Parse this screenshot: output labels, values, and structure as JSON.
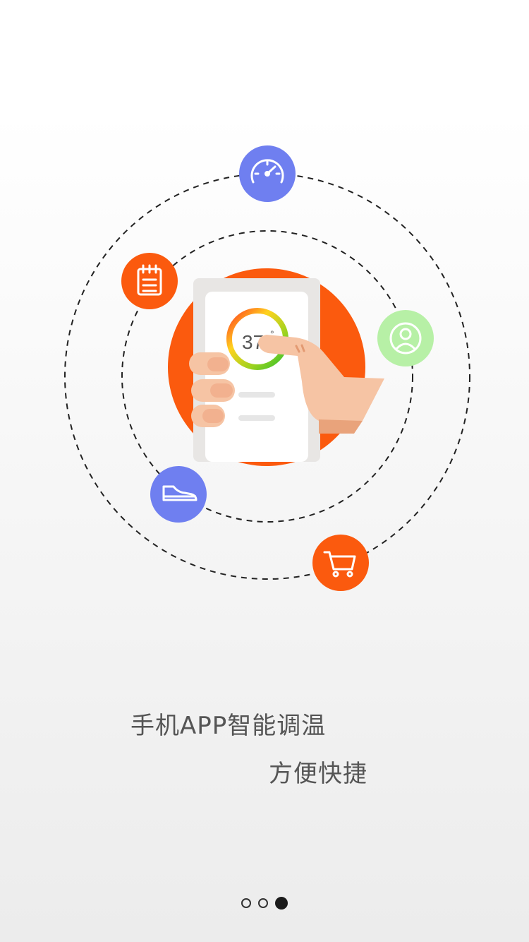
{
  "onboarding": {
    "headline": "手机APP智能调温",
    "subline": "方便快捷",
    "phone_display_value": "37",
    "phone_display_unit": "°"
  },
  "pager": {
    "total": 3,
    "active_index": 2
  },
  "icons": [
    {
      "name": "speedometer-icon",
      "color": "#6f7ff0"
    },
    {
      "name": "notepad-icon",
      "color": "#fb5a0e"
    },
    {
      "name": "user-icon",
      "color": "#b7f0a6"
    },
    {
      "name": "shoe-icon",
      "color": "#6f7ff0"
    },
    {
      "name": "cart-icon",
      "color": "#fb5a0e"
    }
  ],
  "colors": {
    "accent_orange": "#fb5a0e",
    "accent_blue": "#6f7ff0",
    "accent_green": "#b7f0a6",
    "skin": "#f6c4a4"
  }
}
